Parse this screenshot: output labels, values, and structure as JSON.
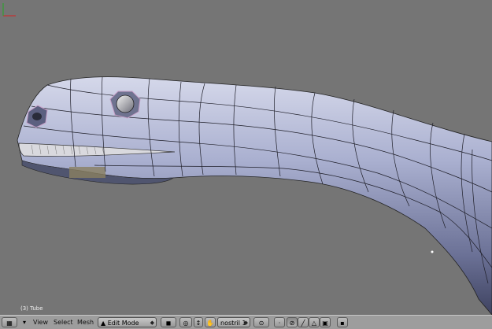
{
  "viewport": {
    "object_label": "(3) Tube",
    "axis": {
      "x_color": "#c83030",
      "y_color": "#30a030"
    }
  },
  "header": {
    "editor_type_icon": "grid-view-icon",
    "collapse_icon": "triangle-down-icon",
    "menus": [
      "View",
      "Select",
      "Mesh"
    ],
    "mode": {
      "label": "Edit Mode",
      "icon": "edit-mode-icon"
    },
    "shading_icon": "solid-shading-icon",
    "pivot_icon": "pivot-point-icon",
    "manipulator_icon": "manipulator-icon",
    "layer_icon": "grab-hand-icon",
    "vertex_group": {
      "label": "nostril 1"
    },
    "proportional_icon": "proportional-edit-icon",
    "select_modes": [
      "vertex-select-icon",
      "edge-select-icon",
      "face-select-icon",
      "occlude-icon"
    ],
    "render_icon": "render-preview-icon"
  },
  "colors": {
    "mesh": "#9fa6c8",
    "wire": "#1a1a1a",
    "background": "#757575",
    "header": "#9d9d9d"
  }
}
